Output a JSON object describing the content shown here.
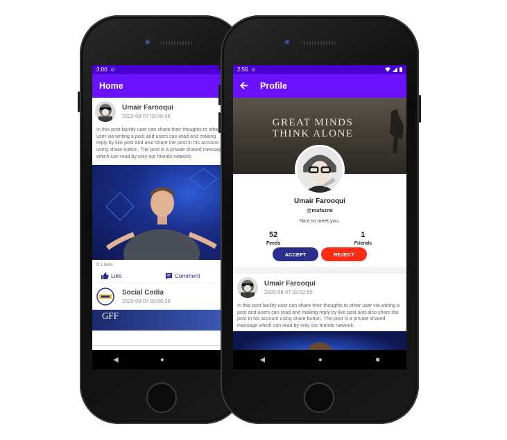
{
  "left_phone": {
    "status": {
      "time": "3:00"
    },
    "appbar": {
      "title": "Home"
    },
    "posts": [
      {
        "name": "Umair Farooqui",
        "date": "2020-08-07 03:00:46",
        "text": "In this post facility user can share their thoughts to other user via writing a post and users can read and making reply by like post and also share the post in his account using share button. The post is a private shared message which can read by only our friends network.",
        "likes": "0 Likes",
        "like_label": "Like",
        "comment_label": "Comment"
      },
      {
        "name": "Social Codia",
        "date": "2020-08-07 03:00:26",
        "image_caption": "GFF"
      }
    ],
    "bottom_nav": [
      "home-icon",
      "friends-icon",
      "notifications-icon"
    ]
  },
  "right_phone": {
    "status": {
      "time": "2:56"
    },
    "appbar": {
      "title": "Profile",
      "back_icon": "arrow-back-icon"
    },
    "cover": {
      "line1": "GREAT MINDS",
      "line2": "THINK ALONE"
    },
    "profile": {
      "name": "Umair Farooqui",
      "handle": "@mufazmi",
      "bio": "Nice to meet you.",
      "feeds_count": "52",
      "feeds_label": "Feeds",
      "friends_count": "1",
      "friends_label": "Friends",
      "accept_label": "ACCEPT",
      "reject_label": "REJECT"
    },
    "post": {
      "name": "Umair Farooqui",
      "date": "2020-08-07 02:52:55",
      "text": "In this post facility user can share their thoughts to other user via writing a post and users can read and making reply by like post and also share the post in his account using share button. The post is a private shared message which can read by only our friends network."
    }
  },
  "colors": {
    "primary": "#6a11ff",
    "status_bar": "#4a00d0",
    "accent_navy": "#2b2f8c",
    "reject_red": "#ff2b14"
  }
}
